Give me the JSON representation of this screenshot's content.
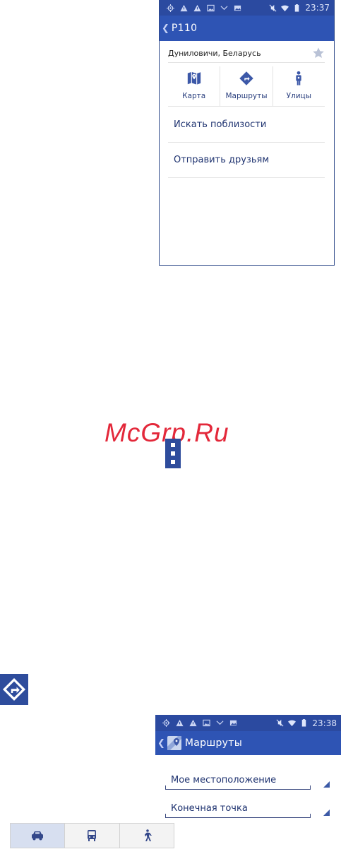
{
  "screen1": {
    "status_time": "23:37",
    "title": "P110",
    "place": "Дуниловичи, Беларусь",
    "actions": [
      {
        "label": "Карта",
        "icon": "map-icon"
      },
      {
        "label": "Маршруты",
        "icon": "directions-icon"
      },
      {
        "label": "Улицы",
        "icon": "street-view-icon"
      }
    ],
    "menu": [
      "Искать поблизости",
      "Отправить друзьям"
    ]
  },
  "watermark": "McGrp.Ru",
  "screen2": {
    "status_time": "23:38",
    "title": "Маршруты",
    "from_value": "Мое местоположение",
    "to_value": "Конечная точка",
    "modes": [
      {
        "icon": "car-icon",
        "active": true
      },
      {
        "icon": "bus-icon",
        "active": false
      },
      {
        "icon": "walk-icon",
        "active": false
      }
    ]
  },
  "colors": {
    "statusbar": "#2b4aa0",
    "appbar": "#2e54b4",
    "accent_text": "#1f3370",
    "watermark": "#e3283a"
  }
}
